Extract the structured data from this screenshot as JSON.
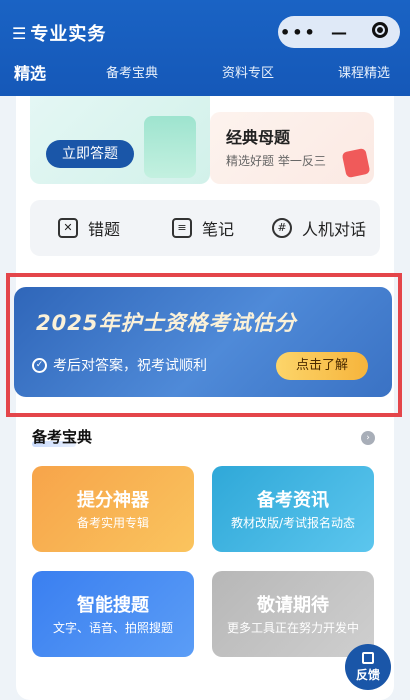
{
  "header": {
    "menu_icon": "list-icon",
    "title": "专业实务",
    "capsule": {
      "more_icon": "more-dots-icon",
      "minimize_icon": "minimize-icon",
      "close_icon": "target-circle-icon"
    }
  },
  "tabs": [
    {
      "label": "精选",
      "active": true
    },
    {
      "label": "备考宝典",
      "active": false
    },
    {
      "label": "资料专区",
      "active": false
    },
    {
      "label": "课程精选",
      "active": false
    }
  ],
  "top_cards": {
    "answer_button": "立即答题",
    "classic": {
      "title": "经典母题",
      "subtitle": "精选好题 举一反三"
    }
  },
  "tools": [
    {
      "label": "错题",
      "icon": "wrong-questions-icon"
    },
    {
      "label": "笔记",
      "icon": "notes-icon"
    },
    {
      "label": "人机对话",
      "icon": "chat-icon"
    }
  ],
  "banner": {
    "title": "2025年护士资格考试估分",
    "subtitle": "考后对答案，祝考试顺利",
    "button": "点击了解"
  },
  "section": {
    "title": "备考宝典"
  },
  "features": [
    {
      "title": "提分神器",
      "subtitle": "备考实用专辑"
    },
    {
      "title": "备考资讯",
      "subtitle": "教材改版/考试报名动态"
    },
    {
      "title": "智能搜题",
      "subtitle": "文字、语音、拍照搜题"
    },
    {
      "title": "敬请期待",
      "subtitle": "更多工具正在努力开发中"
    }
  ],
  "feedback": {
    "label": "反馈",
    "icon": "edit-icon"
  },
  "colors": {
    "brand_blue": "#1a56a8",
    "header_blue": "#1a63c4",
    "highlight_red": "#e4454a",
    "gold": "#f6b43c"
  }
}
